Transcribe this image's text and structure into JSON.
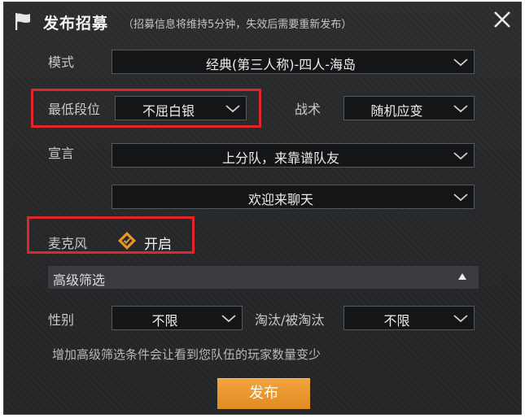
{
  "dialog": {
    "title": "发布招募",
    "subtitle": "（招募信息将维持5分钟，失效后需要重新发布）"
  },
  "form": {
    "mode": {
      "label": "模式",
      "value": "经典(第三人称)-四人-海岛"
    },
    "min_rank": {
      "label": "最低段位",
      "value": "不屈白银"
    },
    "tactic": {
      "label": "战术",
      "value": "随机应变"
    },
    "slogan": {
      "label": "宣言",
      "value1": "上分队，来靠谱队友",
      "value2": "欢迎来聊天"
    },
    "mic": {
      "label": "麦克风",
      "state": "开启",
      "checked": true
    }
  },
  "advanced": {
    "title": "高级筛选",
    "gender": {
      "label": "性别",
      "value": "不限"
    },
    "elimination": {
      "label": "淘汰/被淘汰",
      "value": "不限"
    },
    "hint": "增加高级筛选条件会让看到您队伍的玩家数量变少"
  },
  "actions": {
    "publish_label": "发布"
  },
  "icons": {
    "flag": "flag-icon",
    "close": "close-icon",
    "chevron": "chevron-down-icon",
    "mic_check": "diamond-check-icon",
    "collapse": "triangle-up-icon"
  },
  "colors": {
    "accent": "#e8962c",
    "highlight": "#e0262a",
    "panel": "#27292b"
  }
}
